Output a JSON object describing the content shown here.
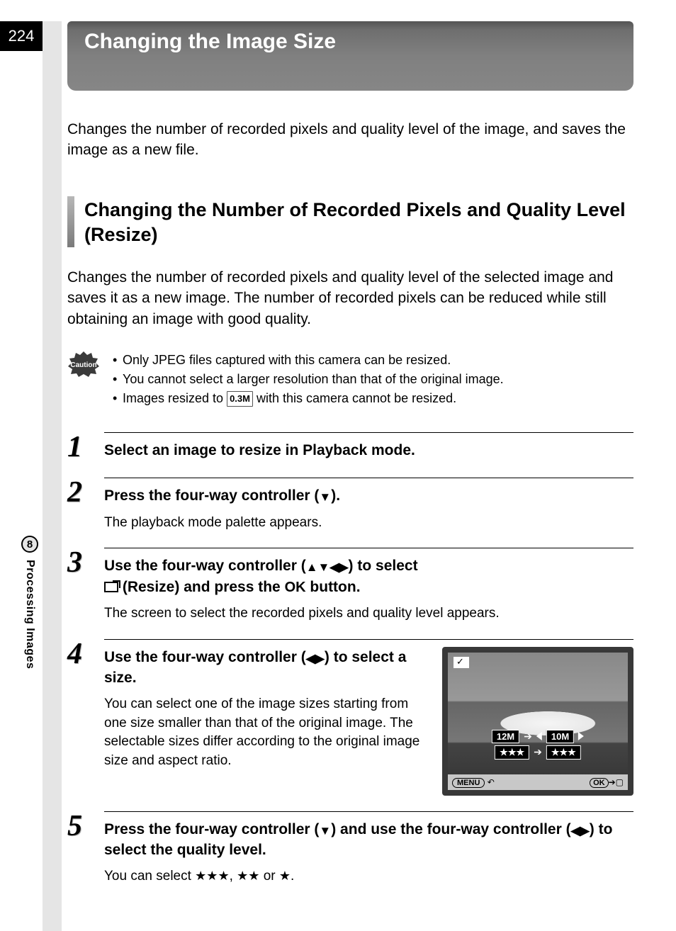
{
  "page_number": "224",
  "sidebar": {
    "chapter_number": "8",
    "chapter_label": "Processing Images"
  },
  "title": "Changing the Image Size",
  "intro": "Changes the number of recorded pixels and quality level of the image, and saves the image as a new file.",
  "subsection": {
    "title": "Changing the Number of Recorded Pixels and Quality Level (Resize)",
    "intro": "Changes the number of recorded pixels and quality level of the selected image and saves it as a new image. The number of recorded pixels can be reduced while still obtaining an image with good quality."
  },
  "caution": {
    "items": [
      "Only JPEG files captured with this camera can be resized.",
      "You cannot select a larger resolution than that of the original image.",
      "Images resized to ",
      " with this camera cannot be resized."
    ],
    "inline_value": "0.3M"
  },
  "steps": {
    "s1": {
      "head": "Select an image to resize in Playback mode."
    },
    "s2": {
      "head_pre": "Press the four-way controller (",
      "head_post": ").",
      "desc": "The playback mode palette appears."
    },
    "s3": {
      "head_a": "Use the four-way controller (",
      "head_b": ") to select ",
      "head_c": " (Resize) and press the ",
      "head_d": " button.",
      "ok_label": "OK",
      "desc": "The screen to select the recorded pixels and quality level appears."
    },
    "s4": {
      "head_a": "Use the four-way controller (",
      "head_b": ") to select a size.",
      "desc": "You can select one of the image sizes starting from one size smaller than that of the original image. The selectable sizes differ according to the original image size and aspect ratio."
    },
    "s5": {
      "head_a": "Press the four-way controller (",
      "head_b": ") and use the four-way controller (",
      "head_c": ") to select the quality level.",
      "desc_a": "You can select ",
      "desc_b": ", ",
      "desc_c": " or ",
      "desc_d": "."
    }
  },
  "screen": {
    "size_from": "12M",
    "size_to": "10M",
    "stars": "★★★",
    "menu_label": "MENU",
    "ok_label": "OK"
  }
}
